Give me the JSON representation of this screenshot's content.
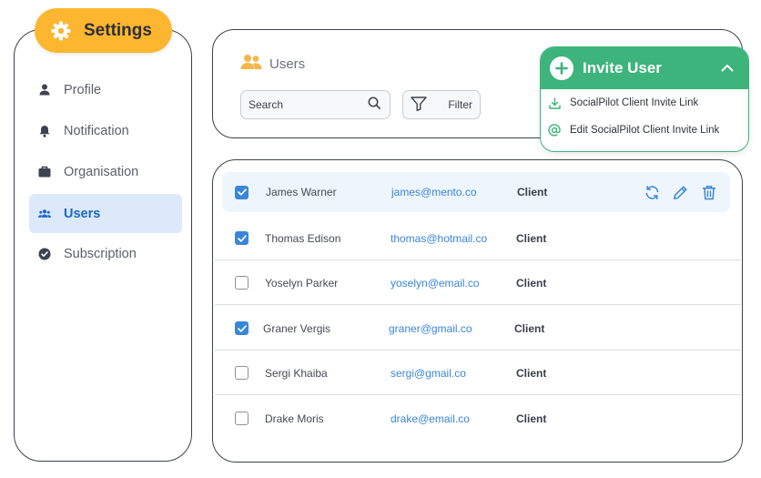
{
  "sidebar": {
    "header_label": "Settings",
    "items": [
      {
        "label": "Profile",
        "icon": "person-icon",
        "active": false
      },
      {
        "label": "Notification",
        "icon": "bell-icon",
        "active": false
      },
      {
        "label": "Organisation",
        "icon": "briefcase-icon",
        "active": false
      },
      {
        "label": "Users",
        "icon": "users-icon",
        "active": true
      },
      {
        "label": "Subscription",
        "icon": "check-circle-icon",
        "active": false
      }
    ]
  },
  "users_panel": {
    "title": "Users",
    "search_placeholder": "Search",
    "filter_label": "Filter"
  },
  "invite_menu": {
    "label": "Invite User",
    "expanded": true,
    "options": [
      {
        "label": "SocialPilot Client Invite Link",
        "icon": "download-icon"
      },
      {
        "label": "Edit  SocialPilot Client Invite Link",
        "icon": "at-sign-icon"
      }
    ]
  },
  "users_table": {
    "rows": [
      {
        "name": "James Warner",
        "email": "james@mento.co",
        "role": "Client",
        "checked": true
      },
      {
        "name": "Thomas Edison",
        "email": "thomas@hotmail.co",
        "role": "Client",
        "checked": true
      },
      {
        "name": "Yoselyn Parker",
        "email": "yoselyn@email.co",
        "role": "Client",
        "checked": false
      },
      {
        "name": "Graner Vergis",
        "email": "graner@gmail.co",
        "role": "Client",
        "checked": true
      },
      {
        "name": "Sergi Khaiba",
        "email": "sergi@gmail.co",
        "role": "Client",
        "checked": false
      },
      {
        "name": "Drake Moris",
        "email": "drake@email.co",
        "role": "Client",
        "checked": false
      }
    ],
    "row_actions": [
      "refresh-icon",
      "edit-pencil-icon",
      "trash-icon"
    ]
  },
  "colors": {
    "accent_yellow": "#fdb62f",
    "active_blue": "#1c66c9",
    "active_bg": "#dbe9fb",
    "invite_green": "#3cb47b",
    "link_blue": "#3a86d8"
  }
}
